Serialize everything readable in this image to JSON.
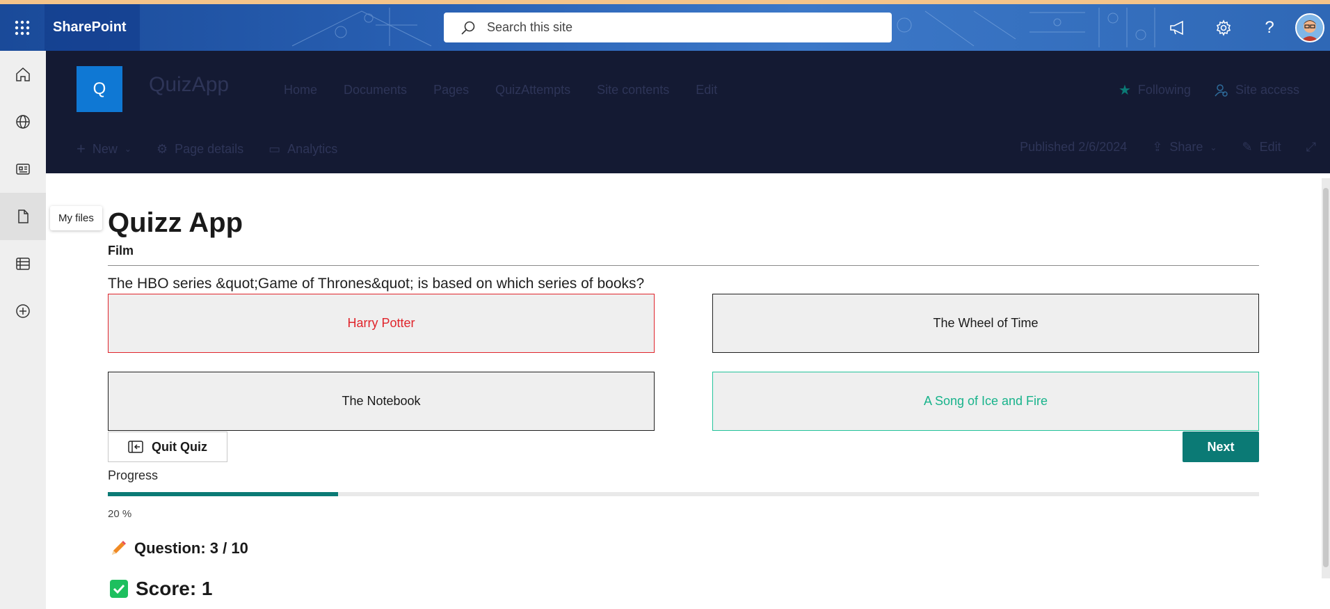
{
  "suite": {
    "brand": "SharePoint",
    "search_placeholder": "Search this site"
  },
  "appbar": {
    "tooltip": "My files"
  },
  "site": {
    "logo_letter": "Q",
    "title": "QuizApp",
    "nav": [
      "Home",
      "Documents",
      "Pages",
      "QuizAttempts",
      "Site contents",
      "Edit"
    ],
    "following": "Following",
    "site_access": "Site access",
    "cmd": {
      "new": "New",
      "page_details": "Page details",
      "analytics": "Analytics",
      "published": "Published 2/6/2024",
      "share": "Share",
      "edit": "Edit"
    }
  },
  "quiz": {
    "title": "Quizz App",
    "category": "Film",
    "question": "The HBO series &quot;Game of Thrones&quot; is based on which series of books?",
    "answers": [
      "Harry Potter",
      "The Wheel of Time",
      "The Notebook",
      "A Song of Ice and Fire"
    ],
    "answer_states": [
      "wrong",
      "neutral",
      "neutral",
      "correct"
    ],
    "quit_label": "Quit Quiz",
    "next_label": "Next",
    "progress_label": "Progress",
    "progress_value": 20,
    "progress_text": "20 %",
    "question_counter": "Question: 3 / 10",
    "score_text": "Score: 1"
  },
  "colors": {
    "accent": "#0b7a75",
    "wrong": "#e0242b",
    "correct": "#18b38b",
    "site_header_bg": "#141a33",
    "logo_bg": "#0f78d4"
  }
}
